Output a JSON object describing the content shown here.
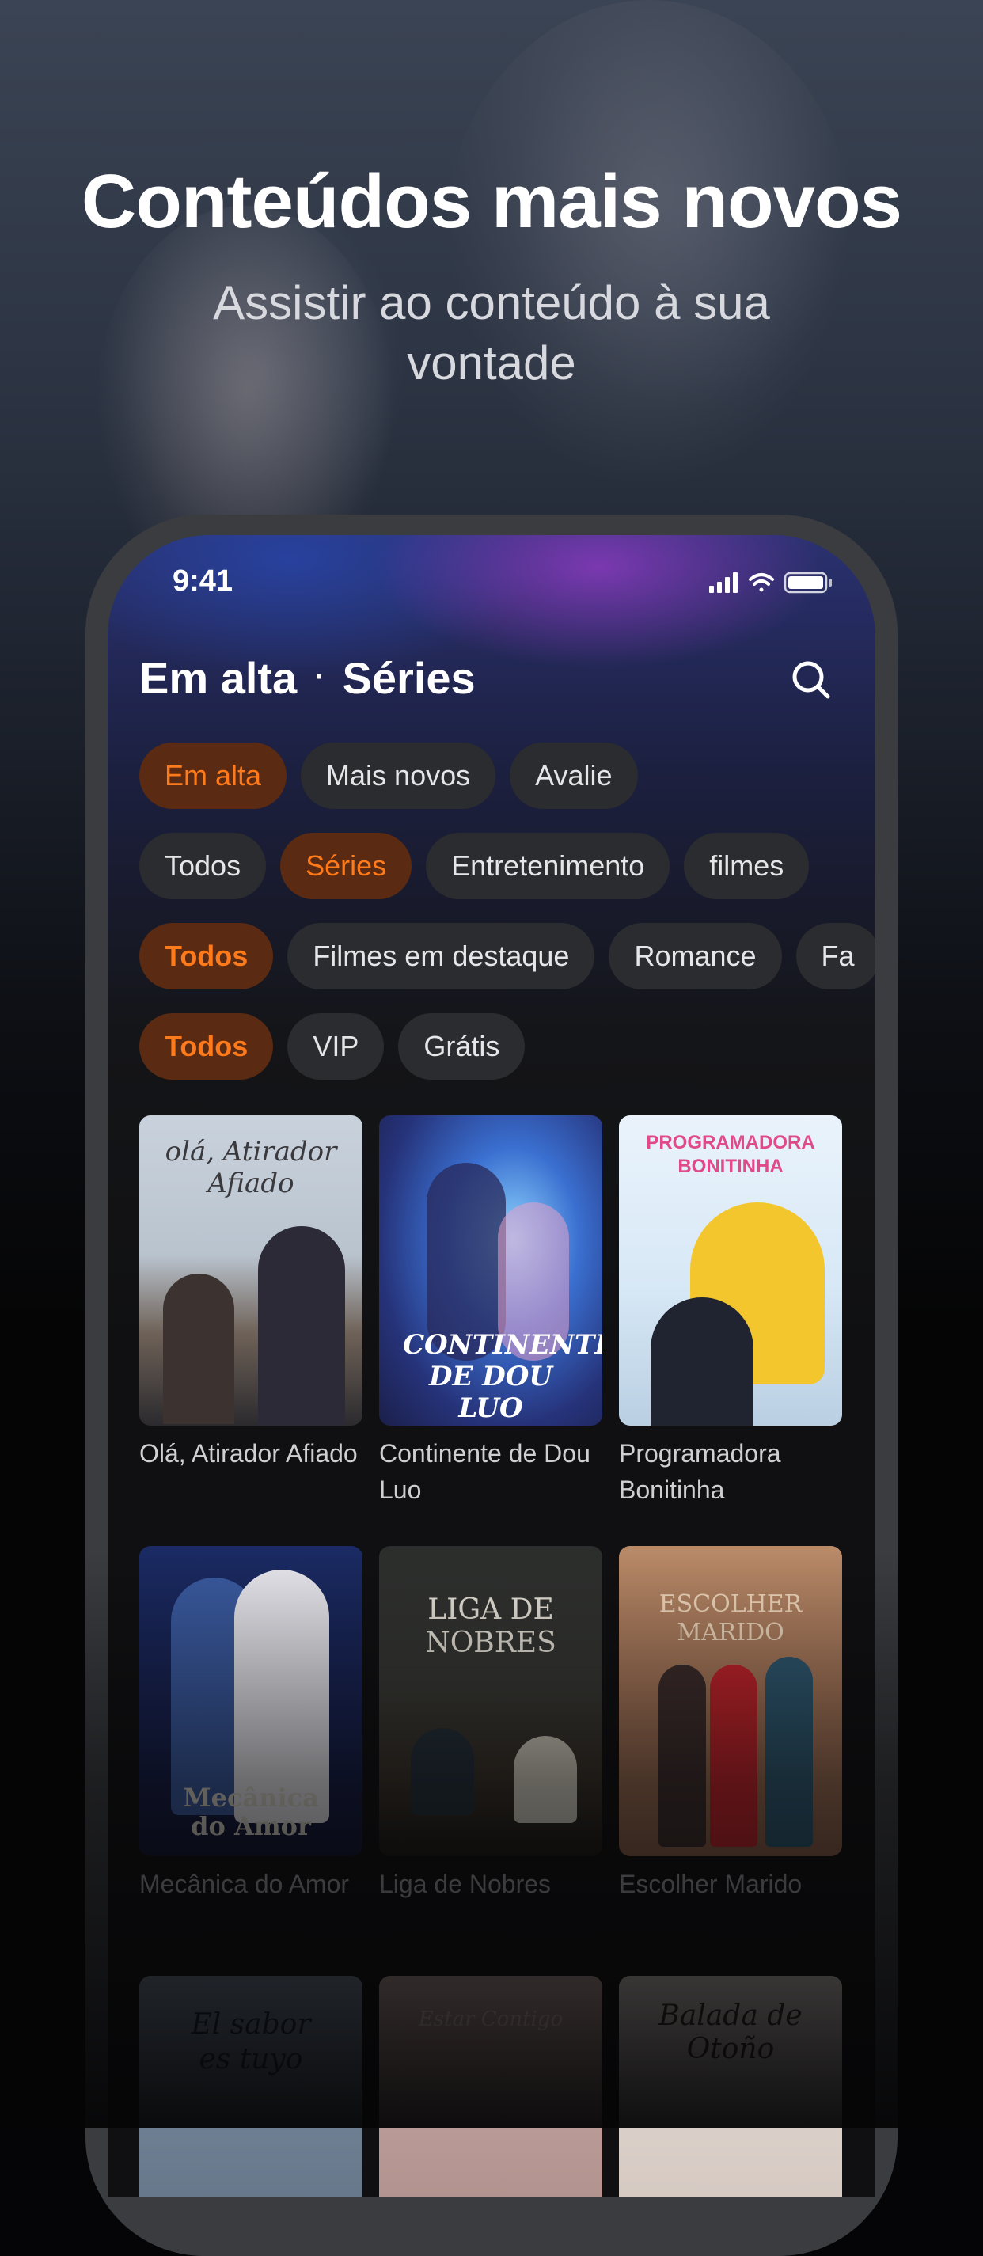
{
  "hero": {
    "title": "Conteúdos mais novos",
    "subtitle": "Assistir ao conteúdo à sua vontade"
  },
  "status_bar": {
    "time": "9:41"
  },
  "header": {
    "part1": "Em alta",
    "separator": "·",
    "part2": "Séries"
  },
  "filters": {
    "row1": [
      "Em alta",
      "Mais novos",
      "Avalie"
    ],
    "row2": [
      "Todos",
      "Séries",
      "Entretenimento",
      "filmes"
    ],
    "row3": [
      "Todos",
      "Filmes em destaque",
      "Romance",
      "Fa"
    ],
    "row4": [
      "Todos",
      "VIP",
      "Grátis"
    ]
  },
  "cards": [
    {
      "label": "Olá, Atirador Afiado",
      "poster_text": "olá, Atirador Afiado"
    },
    {
      "label": "Continente de Dou Luo",
      "poster_text": "CONTINENTE DE DOU LUO"
    },
    {
      "label": "Programadora Bonitinha",
      "poster_text": "PROGRAMADORA BONITINHA"
    },
    {
      "label": "Mecânica do Amor",
      "poster_text": "Mecânica do Amor"
    },
    {
      "label": "Liga de Nobres",
      "poster_text": "LIGA DE NOBRES"
    },
    {
      "label": "Escolher Marido",
      "poster_text": "ESCOLHER MARIDO"
    },
    {
      "label": "",
      "poster_text": "El sabor es tuyo"
    },
    {
      "label": "",
      "poster_text": "Estar Contigo"
    },
    {
      "label": "",
      "poster_text": "Balada de Otoño"
    }
  ],
  "colors": {
    "accent": "#ff7a1a",
    "accent_bg": "#5a2a12",
    "chip_bg": "#2b2c2f"
  }
}
